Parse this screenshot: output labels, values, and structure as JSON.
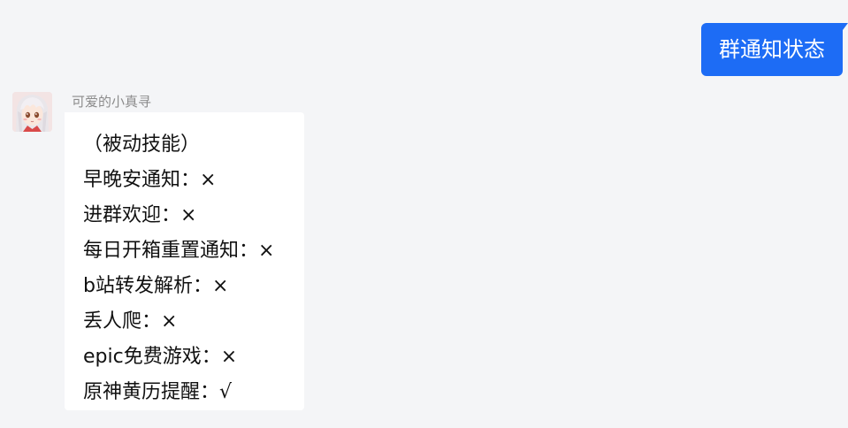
{
  "chat": {
    "outgoing": {
      "text": "群通知状态"
    },
    "incoming": {
      "sender": "可爱的小真寻",
      "avatar_icon": "anime-girl-avatar-icon",
      "lines": [
        "（被动技能）",
        "早晚安通知：×",
        "进群欢迎：×",
        "每日开箱重置通知：×",
        "b站转发解析：×",
        "丢人爬：×",
        "epic免费游戏：×",
        "原神黄历提醒：√"
      ]
    }
  },
  "colors": {
    "background": "#f4f5f7",
    "outgoing_bubble": "#1d6cf5",
    "incoming_bubble": "#ffffff",
    "sender_name": "#8c8c8c"
  }
}
